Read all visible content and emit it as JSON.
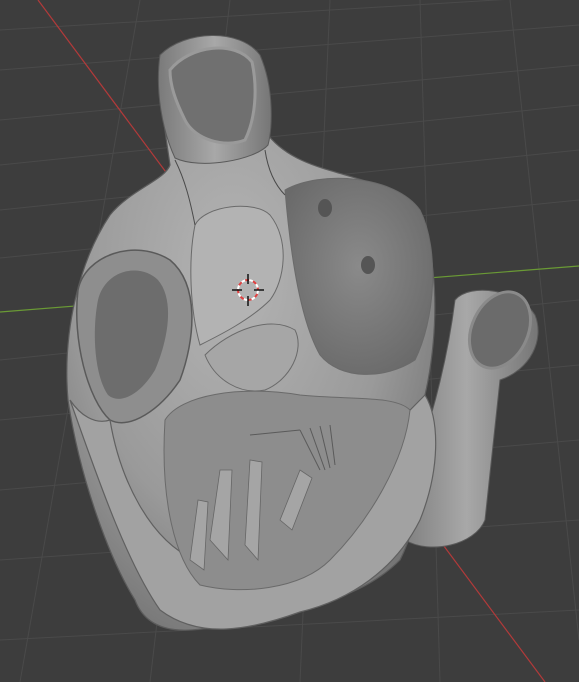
{
  "viewport": {
    "background": "#3d3d3d",
    "grid_color": "#4a4a4a",
    "x_axis_color": "#b23a3a",
    "y_axis_color": "#6a9a35"
  },
  "scene": {
    "object": "heart-mesh",
    "mesh_color": "#9a9a9a",
    "cursor": "3d-cursor-icon"
  }
}
